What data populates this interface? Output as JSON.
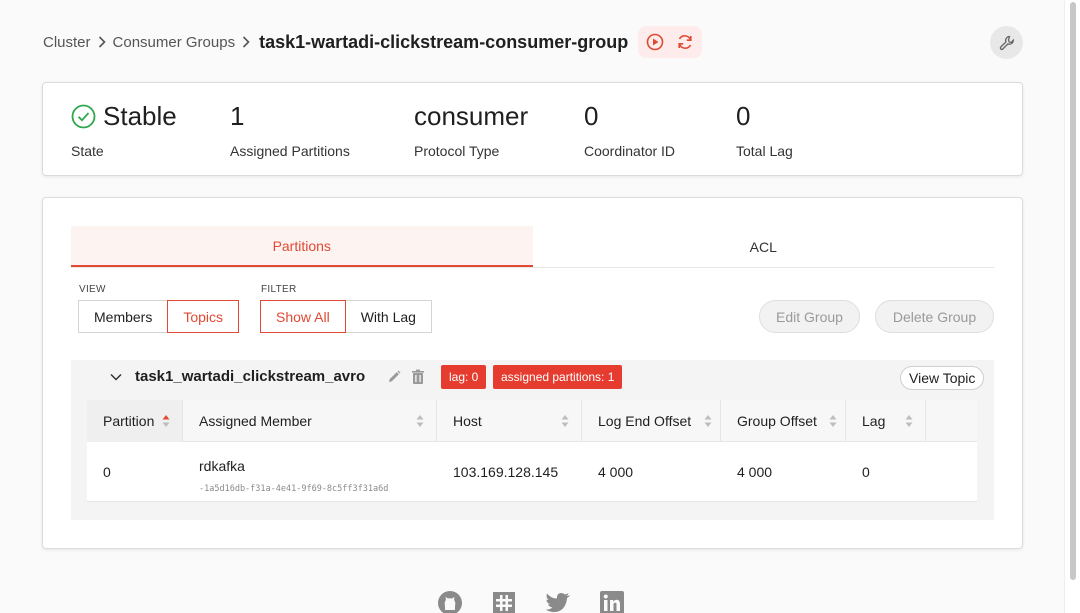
{
  "breadcrumb": {
    "items": [
      "Cluster",
      "Consumer Groups"
    ],
    "title": "task1-wartadi-clickstream-consumer-group"
  },
  "header_actions": [
    "play-circle-icon",
    "refresh-icon"
  ],
  "settings_icon": "wrench-icon",
  "stats": [
    {
      "value": "Stable",
      "label": "State",
      "icon": "check-circle-icon"
    },
    {
      "value": "1",
      "label": "Assigned Partitions"
    },
    {
      "value": "consumer",
      "label": "Protocol Type"
    },
    {
      "value": "0",
      "label": "Coordinator ID"
    },
    {
      "value": "0",
      "label": "Total Lag"
    }
  ],
  "tabs": [
    {
      "label": "Partitions",
      "active": true
    },
    {
      "label": "ACL",
      "active": false
    }
  ],
  "view": {
    "label": "VIEW",
    "options": [
      "Members",
      "Topics"
    ],
    "selected": "Topics"
  },
  "filter": {
    "label": "FILTER",
    "options": [
      "Show All",
      "With Lag"
    ],
    "selected": "Show All"
  },
  "actions": {
    "edit": "Edit Group",
    "delete": "Delete Group"
  },
  "topic": {
    "name": "task1_wartadi_clickstream_avro",
    "lag_badge": "lag: 0",
    "partitions_badge": "assigned partitions: 1",
    "view_topic": "View Topic"
  },
  "table": {
    "columns": [
      "Partition",
      "Assigned Member",
      "Host",
      "Log End Offset",
      "Group Offset",
      "Lag"
    ],
    "rows": [
      {
        "partition": "0",
        "member": "rdkafka",
        "member_id": "-1a5d16db-f31a-4e41-9f69-8c5ff3f31a6d",
        "host": "103.169.128.145",
        "log_end_offset": "4 000",
        "group_offset": "4 000",
        "lag": "0"
      }
    ]
  },
  "colors": {
    "accent": "#e04a34",
    "badge": "#e63c2f",
    "success": "#2fa84f"
  },
  "footer_icons": [
    "github-icon",
    "slack-icon",
    "twitter-icon",
    "linkedin-icon"
  ]
}
